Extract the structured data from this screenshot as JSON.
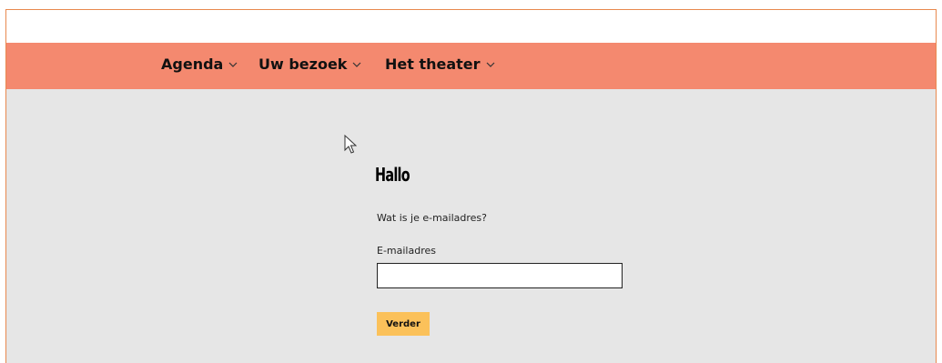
{
  "nav": {
    "items": [
      {
        "label": "Agenda",
        "icon": "chevron-down-icon"
      },
      {
        "label": "Uw bezoek",
        "icon": "chevron-down-icon"
      },
      {
        "label": "Het theater",
        "icon": "chevron-down-icon"
      }
    ]
  },
  "main": {
    "greeting": "Hallo",
    "question": "Wat is je e-mailadres?",
    "email_label": "E-mailadres",
    "email_value": "",
    "next_button": "Verder"
  },
  "colors": {
    "nav_background": "#f4896f",
    "page_background": "#e6e6e6",
    "button_background": "#fbc15a",
    "frame_border": "#e8894f"
  },
  "icons": {
    "cursor": "mouse-pointer-icon"
  }
}
